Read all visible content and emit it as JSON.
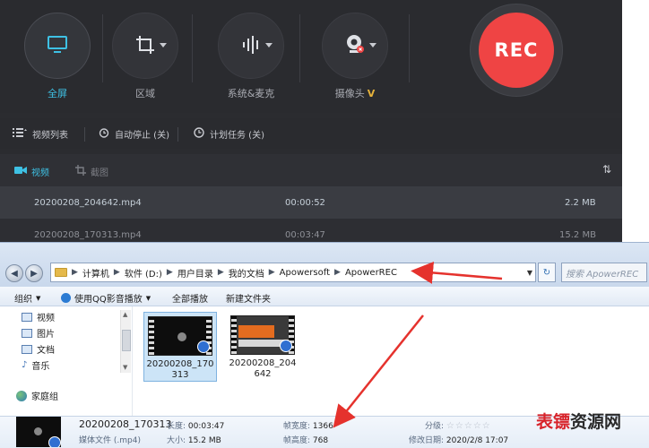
{
  "recorder": {
    "tools": [
      {
        "label": "全屏",
        "icon": "monitor-icon",
        "active": true
      },
      {
        "label": "区域",
        "icon": "crop-icon",
        "active": false
      },
      {
        "label": "系统&麦克",
        "icon": "audio-wave-icon",
        "active": false
      },
      {
        "label": "摄像头",
        "icon": "webcam-icon",
        "active": false
      }
    ],
    "webcam_suffix": "V",
    "rec_label": "REC",
    "subbar": {
      "list_label": "视频列表",
      "auto_stop_label": "自动停止 (关)",
      "schedule_label": "计划任务 (关)"
    },
    "tabs": {
      "video_label": "视频",
      "screenshot_label": "截图"
    },
    "files": [
      {
        "name": "20200208_204642.mp4",
        "duration": "00:00:52",
        "size": "2.2 MB"
      },
      {
        "name": "20200208_170313.mp4",
        "duration": "00:03:47",
        "size": "15.2 MB"
      }
    ],
    "colors": {
      "accent": "#3ec1e4",
      "rec": "#ef4444",
      "bg": "#2b2c30"
    }
  },
  "explorer": {
    "breadcrumbs": [
      "计算机",
      "软件 (D:)",
      "用户目录",
      "我的文档",
      "Apowersoft",
      "ApowerREC"
    ],
    "search_placeholder": "搜索 ApowerREC",
    "commands": {
      "organize": "组织",
      "play_qq": "使用QQ影音播放",
      "play_all": "全部播放",
      "new_folder": "新建文件夹"
    },
    "nav": {
      "video": "视频",
      "picture": "图片",
      "document": "文档",
      "music": "音乐",
      "homegroup": "家庭组"
    },
    "items": [
      {
        "name": "20200208_170313"
      },
      {
        "name": "20200208_204642"
      }
    ],
    "details": {
      "title": "20200208_170313",
      "type": "媒体文件 (.mp4)",
      "length_label": "长度:",
      "length_value": "00:03:47",
      "size_label": "大小:",
      "size_value": "15.2 MB",
      "width_label": "帧宽度:",
      "width_value": "1366",
      "height_label": "帧高度:",
      "height_value": "768",
      "rating_label": "分级:",
      "modified_label": "修改日期:",
      "modified_value": "2020/2/8 17:07"
    }
  },
  "watermark": {
    "part1": "表镖",
    "part2": "资源网"
  }
}
